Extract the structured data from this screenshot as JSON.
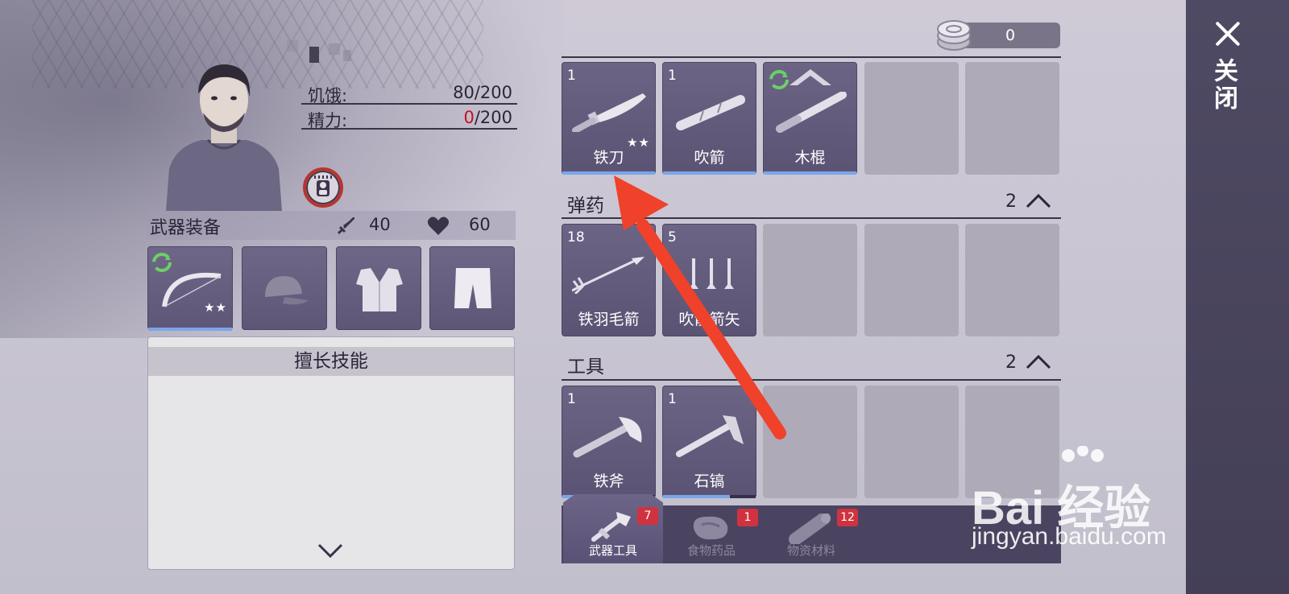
{
  "character": {
    "stats": [
      {
        "label": "饥饿:",
        "current": "80",
        "max": "/200",
        "low": false
      },
      {
        "label": "精力:",
        "current": "0",
        "max": "/200",
        "low": true
      }
    ]
  },
  "equipment": {
    "title": "武器装备",
    "attack": "40",
    "health": "60",
    "slots": [
      {
        "icon": "bow-icon",
        "stars": "★★",
        "refreshable": true,
        "active": true
      },
      {
        "icon": "cap-icon",
        "active": false
      },
      {
        "icon": "vest-icon",
        "active": false
      },
      {
        "icon": "shorts-icon",
        "active": false
      }
    ]
  },
  "skills": {
    "title": "擅长技能"
  },
  "currency": {
    "icon": "coin-icon",
    "amount": "0"
  },
  "close": {
    "label": "关闭"
  },
  "inventory": {
    "weapons": [
      {
        "qty": "1",
        "name": "铁刀",
        "icon": "knife-icon",
        "stars": "★★",
        "durability": 1.0
      },
      {
        "qty": "1",
        "name": "吹箭",
        "icon": "blowpipe-icon",
        "durability": 1.0
      },
      {
        "qty": "",
        "name": "木棍",
        "icon": "stick-icon",
        "refreshable": true,
        "upgrade": true,
        "durability": 1.0
      }
    ],
    "ammo": {
      "title": "弹药",
      "count": "2",
      "items": [
        {
          "qty": "18",
          "name": "铁羽毛箭",
          "icon": "arrow-icon"
        },
        {
          "qty": "5",
          "name": "吹箭箭矢",
          "icon": "darts-icon"
        }
      ]
    },
    "tools": {
      "title": "工具",
      "count": "2",
      "items": [
        {
          "qty": "1",
          "name": "铁斧",
          "icon": "axe-icon",
          "durability": 0.72
        },
        {
          "qty": "1",
          "name": "石镐",
          "icon": "pickaxe-icon",
          "durability": 0.72
        }
      ]
    }
  },
  "tabs": [
    {
      "label": "武器工具",
      "badge": "7",
      "icon": "hammer-axe-icon",
      "active": true
    },
    {
      "label": "食物药品",
      "badge": "1",
      "icon": "meat-icon",
      "active": false
    },
    {
      "label": "物资材料",
      "badge": "12",
      "icon": "log-icon",
      "active": false
    }
  ],
  "watermark": {
    "brand": "Bai 经验",
    "url": "jingyan.baidu.com"
  },
  "colors": {
    "accent_blue": "#7aa6ea",
    "alert_red": "#c0141e",
    "badge_red": "#d0333f",
    "slot_purple": "#6c6484",
    "annotation_arrow": "#f0412b"
  }
}
